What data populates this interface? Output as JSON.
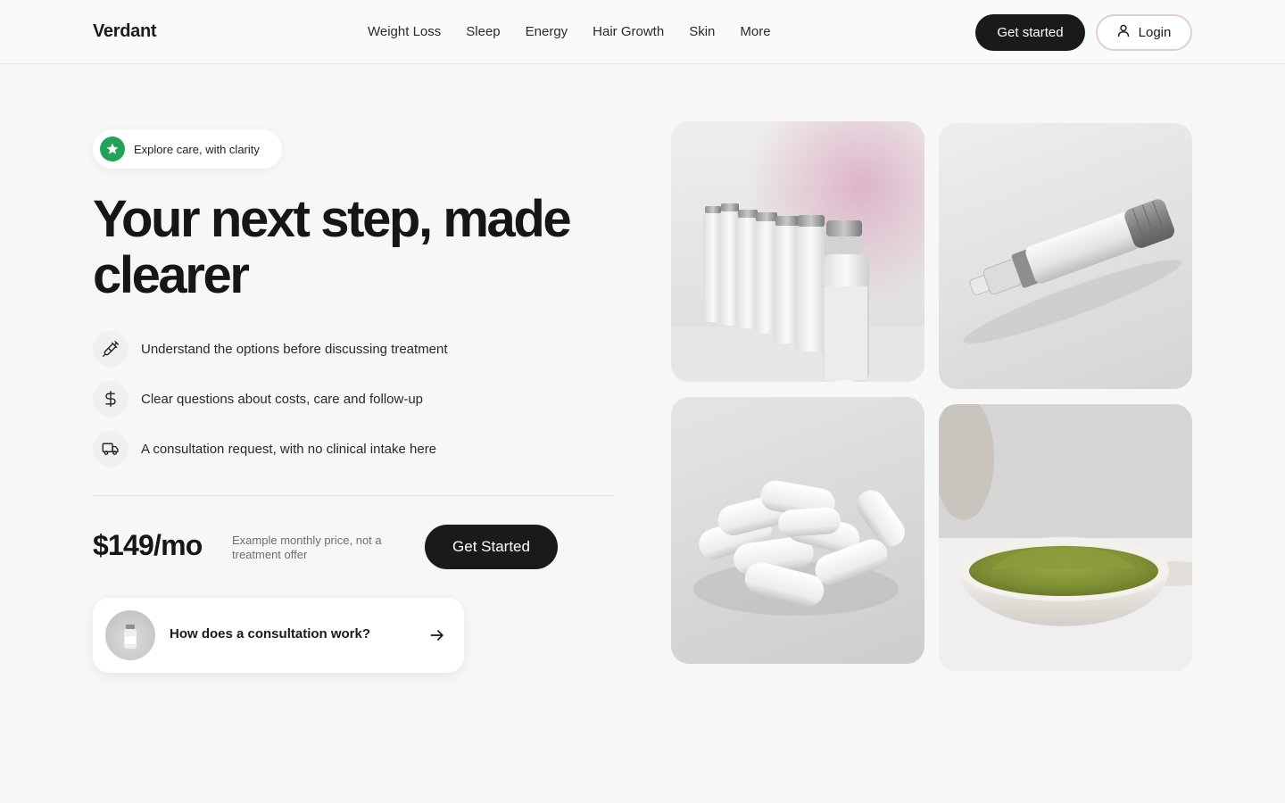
{
  "header": {
    "logo": "Verdant",
    "nav": [
      "Weight Loss",
      "Sleep",
      "Energy",
      "Hair Growth",
      "Skin",
      "More"
    ],
    "get_started_label": "Get started",
    "login_label": "Login"
  },
  "hero": {
    "pill_text": "Explore care, with clarity",
    "headline": "Your next step, made clearer",
    "features": [
      {
        "icon": "syringe-icon",
        "text": "Understand the options before discussing treatment"
      },
      {
        "icon": "dollar-icon",
        "text": "Clear questions about costs, care and follow-up"
      },
      {
        "icon": "truck-icon",
        "text": "A consultation request, with no clinical intake here"
      }
    ],
    "price": "$149/mo",
    "price_note": "Example monthly price, not a treatment offer",
    "cta_label": "Get Started",
    "consult_card_text": "How does a consultation work?"
  },
  "colors": {
    "primary_dark": "#1b1a18",
    "accent_green": "#23a35a",
    "login_border": "#e4cfc6",
    "background": "#f7f7f7"
  },
  "images": [
    "vials-image",
    "injection-pen-image",
    "capsules-image",
    "green-powder-bowl-image"
  ]
}
